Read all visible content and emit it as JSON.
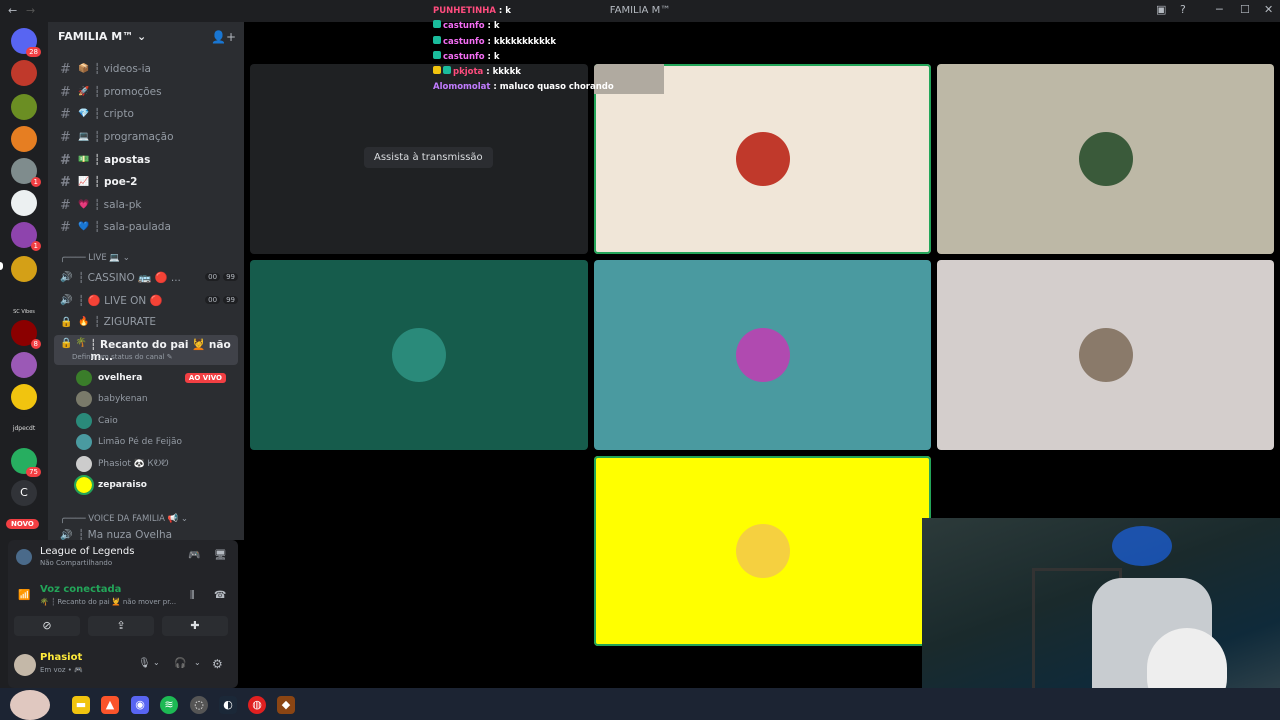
{
  "window": {
    "title": "FAMILIA M™",
    "back": "←",
    "forward": "→"
  },
  "server": {
    "name": "FAMILIA M™ ⌄"
  },
  "guild_badges": {
    "home": "28",
    "g5": "1",
    "g7": "1",
    "g9": "8",
    "g12": "75",
    "letter": "C",
    "novo": "NOVO",
    "gvibes": "SC Vibes",
    "jdpecdt": "jdpecdt"
  },
  "channels": [
    {
      "emoji": "📦",
      "label": "┆ videos-ia"
    },
    {
      "emoji": "🚀",
      "label": "┆ promoções"
    },
    {
      "emoji": "💎",
      "label": "┆ cripto"
    },
    {
      "emoji": "💻",
      "label": "┆ programação"
    },
    {
      "emoji": "💵",
      "label": "┆ apostas"
    },
    {
      "emoji": "📈",
      "label": "┆ poe-2"
    },
    {
      "emoji": "💗",
      "label": "┆ sala-pk"
    },
    {
      "emoji": "💙",
      "label": "┆ sala-paulada"
    }
  ],
  "cat_live": "╭──── LIVE 💻 ⌄",
  "voice_channels": [
    {
      "label": "┆ CASSINO 🚌 🔴 ...",
      "c1": "00",
      "c2": "99"
    },
    {
      "label": "┆ 🔴 LIVE ON 🔴",
      "c1": "00",
      "c2": "99"
    },
    {
      "label": "┆ ZIGURATE"
    },
    {
      "label": "┆ Recanto do pai 💆 não m...",
      "status": "Definir um status do canal ✎"
    }
  ],
  "voice_users": [
    {
      "name": "ovelhera",
      "live": "AO VIVO"
    },
    {
      "name": "babykenan"
    },
    {
      "name": "Caio"
    },
    {
      "name": "Limão Pé de Feijão"
    },
    {
      "name": "Phasiot 🐼 ᏦᎧᏬ"
    },
    {
      "name": "zeparaiso"
    }
  ],
  "cat_voice": "╭──── VOICE DA FAMILIA 📢 ⌄",
  "cat_voice_next": "┆ Ma nuza Ovelha",
  "panel": {
    "activity_title": "League of Legends",
    "activity_sub": "Não Compartilhando",
    "voice_status": "Voz conectada",
    "voice_channel": "🌴 ┆ Recanto do pai 💆 não mover pr...",
    "user_name": "Phasiot",
    "user_status": "Em voz • 🎮"
  },
  "stage": {
    "watch_label": "Assista à transmissão"
  },
  "chat": [
    {
      "user": "PUNHETINHA",
      "msg": " : k",
      "cls": "u1"
    },
    {
      "user": "castunfo",
      "msg": " : k",
      "cls": "u2"
    },
    {
      "user": "castunfo",
      "msg": " : kkkkkkkkkkk",
      "cls": "u2"
    },
    {
      "user": "castunfo",
      "msg": " : k",
      "cls": "u2"
    },
    {
      "user": "pkjota",
      "msg": " : kkkkk",
      "cls": "u2"
    },
    {
      "user": "Alomomolat",
      "msg": " : maluco quaso chorando",
      "cls": "u3"
    }
  ],
  "colors": {
    "accent": "#5865f2",
    "speaking": "#23a559",
    "live": "#f23f43"
  }
}
